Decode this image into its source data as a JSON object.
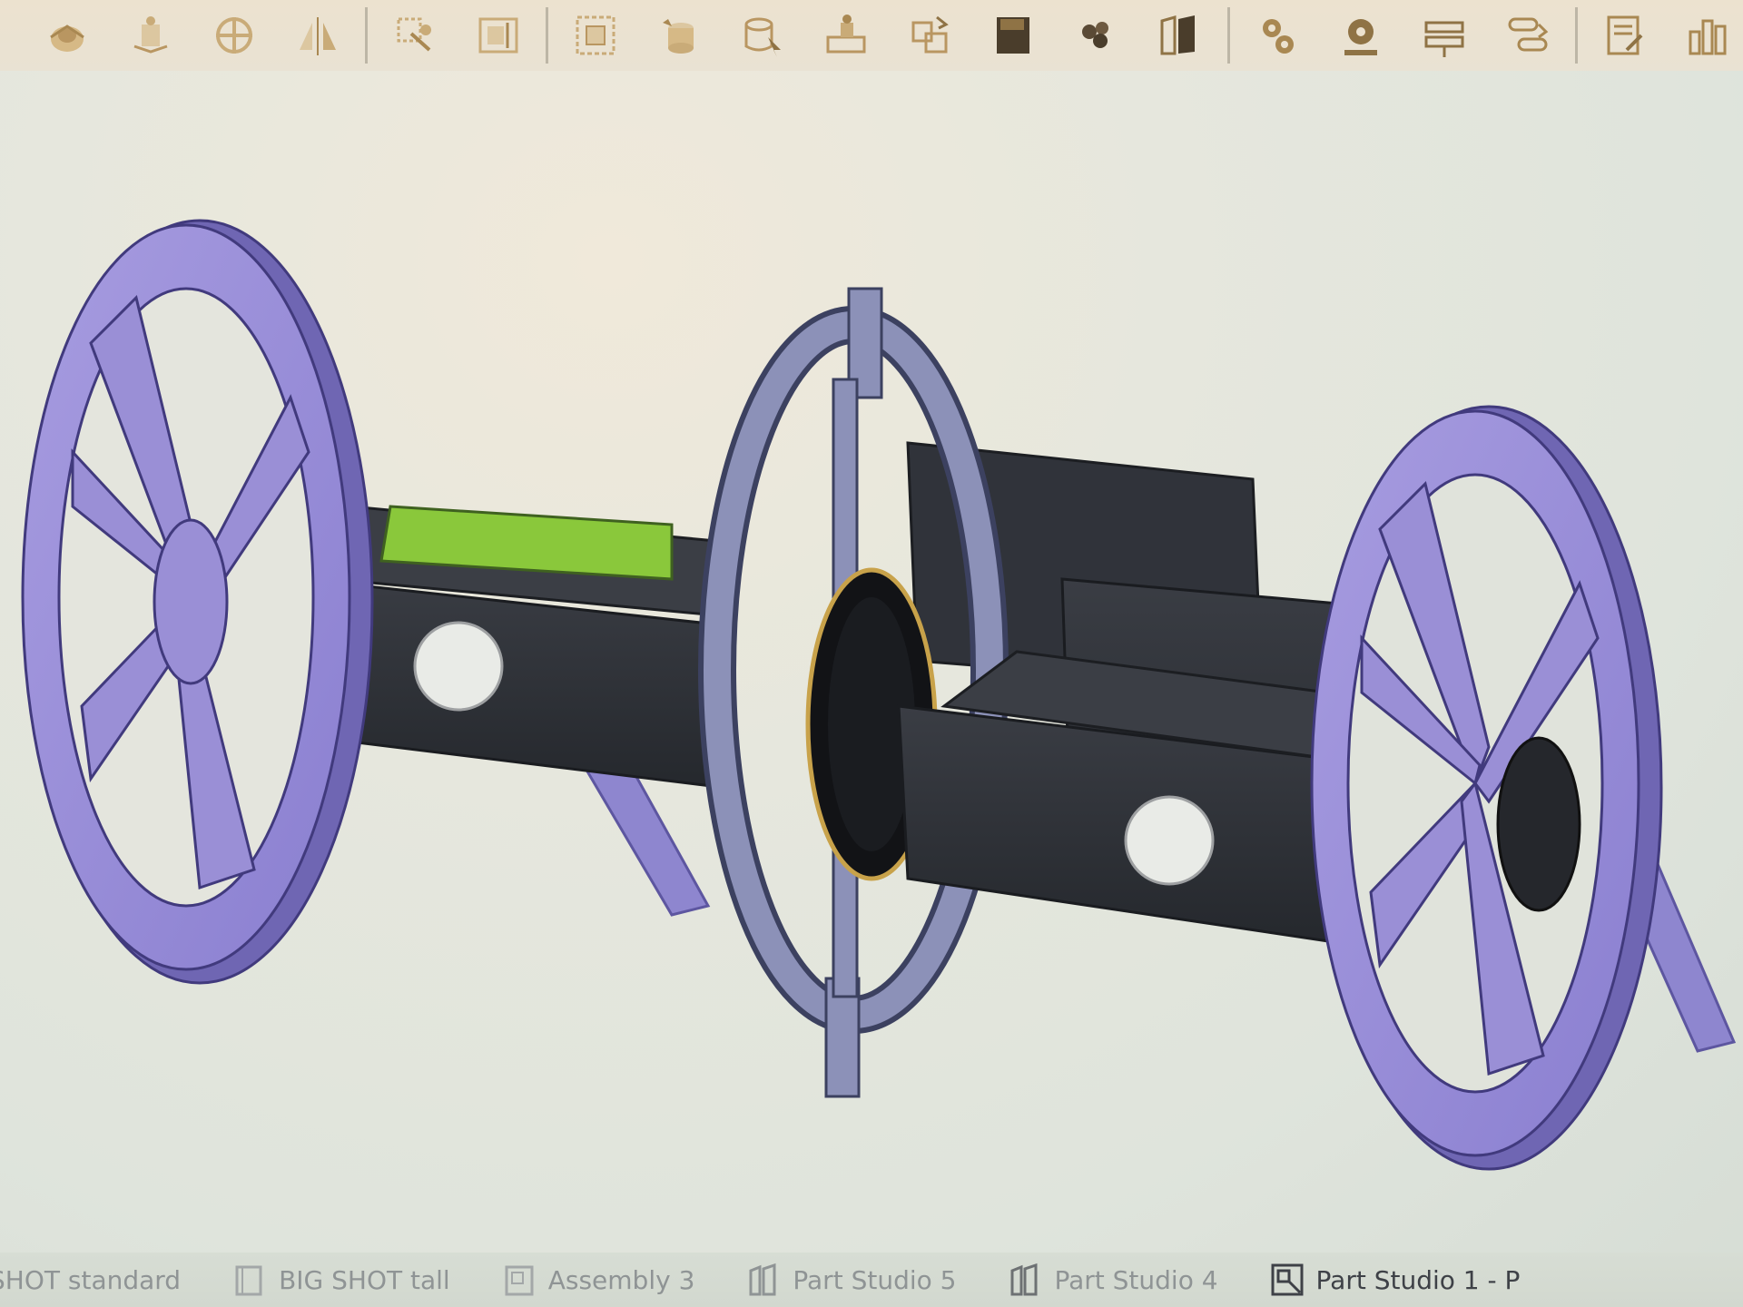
{
  "toolbar": {
    "tools": [
      {
        "id": "tool-1",
        "icon": "move-icon"
      },
      {
        "id": "tool-2",
        "icon": "revolve-icon"
      },
      {
        "id": "tool-3",
        "icon": "fastened-mate-icon"
      },
      {
        "id": "tool-4",
        "icon": "mirror-icon"
      },
      {
        "id": "tool-5",
        "icon": "transform-icon"
      },
      {
        "id": "tool-6",
        "icon": "frame-icon"
      },
      {
        "id": "tool-7",
        "icon": "pattern-icon"
      },
      {
        "id": "tool-8",
        "icon": "insert-part-icon"
      },
      {
        "id": "tool-9",
        "icon": "select-part-icon"
      },
      {
        "id": "tool-10",
        "icon": "mate-connector-icon"
      },
      {
        "id": "tool-11",
        "icon": "interference-icon"
      },
      {
        "id": "tool-12",
        "icon": "save-icon"
      },
      {
        "id": "tool-13",
        "icon": "group-icon"
      },
      {
        "id": "tool-14",
        "icon": "book-icon"
      },
      {
        "id": "tool-15",
        "icon": "gear-pair-icon"
      },
      {
        "id": "tool-16",
        "icon": "gear-settings-icon"
      },
      {
        "id": "tool-17",
        "icon": "belt-icon"
      },
      {
        "id": "tool-18",
        "icon": "linear-relation-icon"
      },
      {
        "id": "tool-19",
        "icon": "report-icon"
      },
      {
        "id": "tool-20",
        "icon": "bar-chart-icon"
      }
    ],
    "colors": {
      "icon": "#c9ab78",
      "icon_dark": "#a98852",
      "separator": "#bdb6a6"
    }
  },
  "viewport": {
    "colors": {
      "wheel": "#9a8fd6",
      "wheel_dark": "#6f66b3",
      "chassis": "#2d3036",
      "accent_green": "#8ac83b",
      "ring": "#8c91b8"
    }
  },
  "tabs": [
    {
      "label": "SHOT standard",
      "icon": "part-studio-icon",
      "active": false
    },
    {
      "label": "BIG SHOT tall",
      "icon": "part-studio-icon",
      "active": false
    },
    {
      "label": "Assembly 3",
      "icon": "assembly-icon",
      "active": false
    },
    {
      "label": "Part Studio 5",
      "icon": "part-studio-icon",
      "active": false
    },
    {
      "label": "Part Studio 4",
      "icon": "part-studio-icon",
      "active": false
    },
    {
      "label": "Part Studio 1 - P",
      "icon": "assembly-icon",
      "active": true
    }
  ]
}
